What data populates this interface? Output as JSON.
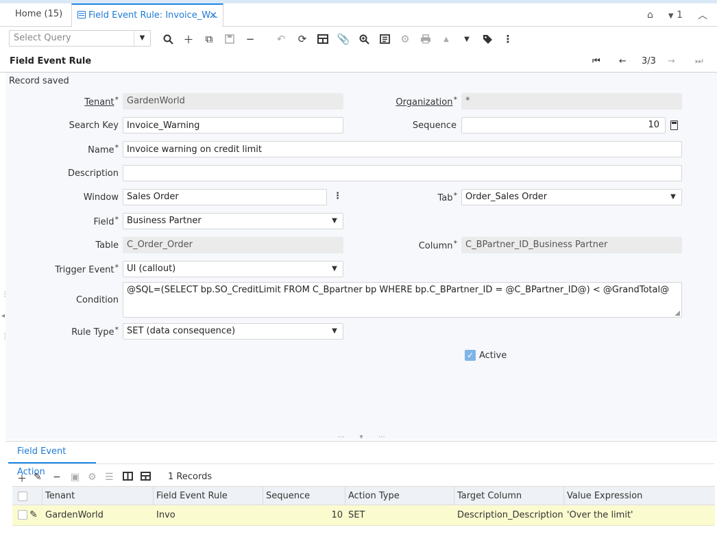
{
  "tabs": {
    "home": "Home (15)",
    "active": "Field Event Rule: Invoice_W..."
  },
  "header_right": {
    "count": "1"
  },
  "toolbar": {
    "select_query_placeholder": "Select Query"
  },
  "titlebar": {
    "title": "Field Event Rule",
    "record_nav": "3/3"
  },
  "status": "Record saved",
  "form": {
    "tenant_label": "Tenant",
    "tenant_value": "GardenWorld",
    "organization_label": "Organization",
    "organization_value": "*",
    "search_key_label": "Search Key",
    "search_key_value": "Invoice_Warning",
    "sequence_label": "Sequence",
    "sequence_value": "10",
    "name_label": "Name",
    "name_value": "Invoice warning on credit limit",
    "description_label": "Description",
    "description_value": "",
    "window_label": "Window",
    "window_value": "Sales Order",
    "tab_label": "Tab",
    "tab_value": "Order_Sales Order",
    "field_label": "Field",
    "field_value": "Business Partner",
    "table_label": "Table",
    "table_value": "C_Order_Order",
    "column_label": "Column",
    "column_value": "C_BPartner_ID_Business Partner",
    "trigger_event_label": "Trigger Event",
    "trigger_event_value": "UI (callout)",
    "condition_label": "Condition",
    "condition_value": "@SQL=(SELECT bp.SO_CreditLimit FROM C_Bpartner bp WHERE bp.C_BPartner_ID = @C_BPartner_ID@) < @GrandTotal@",
    "rule_type_label": "Rule Type",
    "rule_type_value": "SET (data consequence)",
    "active_label": "Active",
    "active_checked": true
  },
  "detail": {
    "tab_label": "Field Event Action",
    "records": "1 Records",
    "columns": [
      "Tenant",
      "Field Event Rule",
      "Sequence",
      "Action Type",
      "Target Column",
      "Value Expression"
    ],
    "rows": [
      [
        "GardenWorld",
        "Invo",
        "10",
        "SET",
        "Description_Description",
        "'Over the limit'"
      ]
    ]
  },
  "colors": {
    "accent": "#1e88e5",
    "row_highlight": "#fbfbd0",
    "form_bg": "#f6f8fb"
  }
}
